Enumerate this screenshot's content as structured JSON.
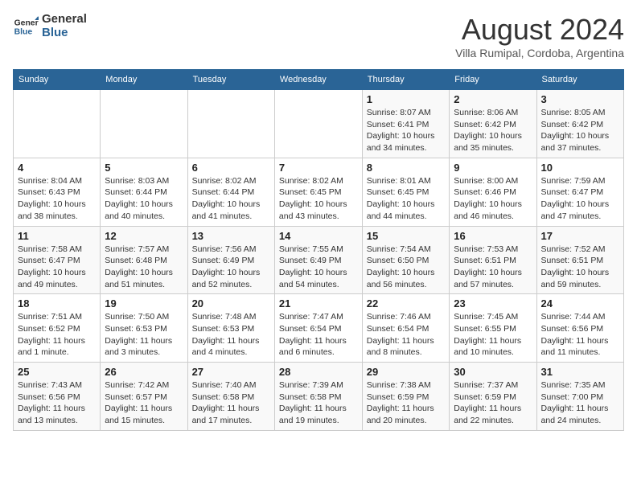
{
  "logo": {
    "line1": "General",
    "line2": "Blue"
  },
  "title": "August 2024",
  "subtitle": "Villa Rumipal, Cordoba, Argentina",
  "days_of_week": [
    "Sunday",
    "Monday",
    "Tuesday",
    "Wednesday",
    "Thursday",
    "Friday",
    "Saturday"
  ],
  "weeks": [
    [
      {
        "day": "",
        "info": ""
      },
      {
        "day": "",
        "info": ""
      },
      {
        "day": "",
        "info": ""
      },
      {
        "day": "",
        "info": ""
      },
      {
        "day": "1",
        "info": "Sunrise: 8:07 AM\nSunset: 6:41 PM\nDaylight: 10 hours\nand 34 minutes."
      },
      {
        "day": "2",
        "info": "Sunrise: 8:06 AM\nSunset: 6:42 PM\nDaylight: 10 hours\nand 35 minutes."
      },
      {
        "day": "3",
        "info": "Sunrise: 8:05 AM\nSunset: 6:42 PM\nDaylight: 10 hours\nand 37 minutes."
      }
    ],
    [
      {
        "day": "4",
        "info": "Sunrise: 8:04 AM\nSunset: 6:43 PM\nDaylight: 10 hours\nand 38 minutes."
      },
      {
        "day": "5",
        "info": "Sunrise: 8:03 AM\nSunset: 6:44 PM\nDaylight: 10 hours\nand 40 minutes."
      },
      {
        "day": "6",
        "info": "Sunrise: 8:02 AM\nSunset: 6:44 PM\nDaylight: 10 hours\nand 41 minutes."
      },
      {
        "day": "7",
        "info": "Sunrise: 8:02 AM\nSunset: 6:45 PM\nDaylight: 10 hours\nand 43 minutes."
      },
      {
        "day": "8",
        "info": "Sunrise: 8:01 AM\nSunset: 6:45 PM\nDaylight: 10 hours\nand 44 minutes."
      },
      {
        "day": "9",
        "info": "Sunrise: 8:00 AM\nSunset: 6:46 PM\nDaylight: 10 hours\nand 46 minutes."
      },
      {
        "day": "10",
        "info": "Sunrise: 7:59 AM\nSunset: 6:47 PM\nDaylight: 10 hours\nand 47 minutes."
      }
    ],
    [
      {
        "day": "11",
        "info": "Sunrise: 7:58 AM\nSunset: 6:47 PM\nDaylight: 10 hours\nand 49 minutes."
      },
      {
        "day": "12",
        "info": "Sunrise: 7:57 AM\nSunset: 6:48 PM\nDaylight: 10 hours\nand 51 minutes."
      },
      {
        "day": "13",
        "info": "Sunrise: 7:56 AM\nSunset: 6:49 PM\nDaylight: 10 hours\nand 52 minutes."
      },
      {
        "day": "14",
        "info": "Sunrise: 7:55 AM\nSunset: 6:49 PM\nDaylight: 10 hours\nand 54 minutes."
      },
      {
        "day": "15",
        "info": "Sunrise: 7:54 AM\nSunset: 6:50 PM\nDaylight: 10 hours\nand 56 minutes."
      },
      {
        "day": "16",
        "info": "Sunrise: 7:53 AM\nSunset: 6:51 PM\nDaylight: 10 hours\nand 57 minutes."
      },
      {
        "day": "17",
        "info": "Sunrise: 7:52 AM\nSunset: 6:51 PM\nDaylight: 10 hours\nand 59 minutes."
      }
    ],
    [
      {
        "day": "18",
        "info": "Sunrise: 7:51 AM\nSunset: 6:52 PM\nDaylight: 11 hours\nand 1 minute."
      },
      {
        "day": "19",
        "info": "Sunrise: 7:50 AM\nSunset: 6:53 PM\nDaylight: 11 hours\nand 3 minutes."
      },
      {
        "day": "20",
        "info": "Sunrise: 7:48 AM\nSunset: 6:53 PM\nDaylight: 11 hours\nand 4 minutes."
      },
      {
        "day": "21",
        "info": "Sunrise: 7:47 AM\nSunset: 6:54 PM\nDaylight: 11 hours\nand 6 minutes."
      },
      {
        "day": "22",
        "info": "Sunrise: 7:46 AM\nSunset: 6:54 PM\nDaylight: 11 hours\nand 8 minutes."
      },
      {
        "day": "23",
        "info": "Sunrise: 7:45 AM\nSunset: 6:55 PM\nDaylight: 11 hours\nand 10 minutes."
      },
      {
        "day": "24",
        "info": "Sunrise: 7:44 AM\nSunset: 6:56 PM\nDaylight: 11 hours\nand 11 minutes."
      }
    ],
    [
      {
        "day": "25",
        "info": "Sunrise: 7:43 AM\nSunset: 6:56 PM\nDaylight: 11 hours\nand 13 minutes."
      },
      {
        "day": "26",
        "info": "Sunrise: 7:42 AM\nSunset: 6:57 PM\nDaylight: 11 hours\nand 15 minutes."
      },
      {
        "day": "27",
        "info": "Sunrise: 7:40 AM\nSunset: 6:58 PM\nDaylight: 11 hours\nand 17 minutes."
      },
      {
        "day": "28",
        "info": "Sunrise: 7:39 AM\nSunset: 6:58 PM\nDaylight: 11 hours\nand 19 minutes."
      },
      {
        "day": "29",
        "info": "Sunrise: 7:38 AM\nSunset: 6:59 PM\nDaylight: 11 hours\nand 20 minutes."
      },
      {
        "day": "30",
        "info": "Sunrise: 7:37 AM\nSunset: 6:59 PM\nDaylight: 11 hours\nand 22 minutes."
      },
      {
        "day": "31",
        "info": "Sunrise: 7:35 AM\nSunset: 7:00 PM\nDaylight: 11 hours\nand 24 minutes."
      }
    ]
  ]
}
